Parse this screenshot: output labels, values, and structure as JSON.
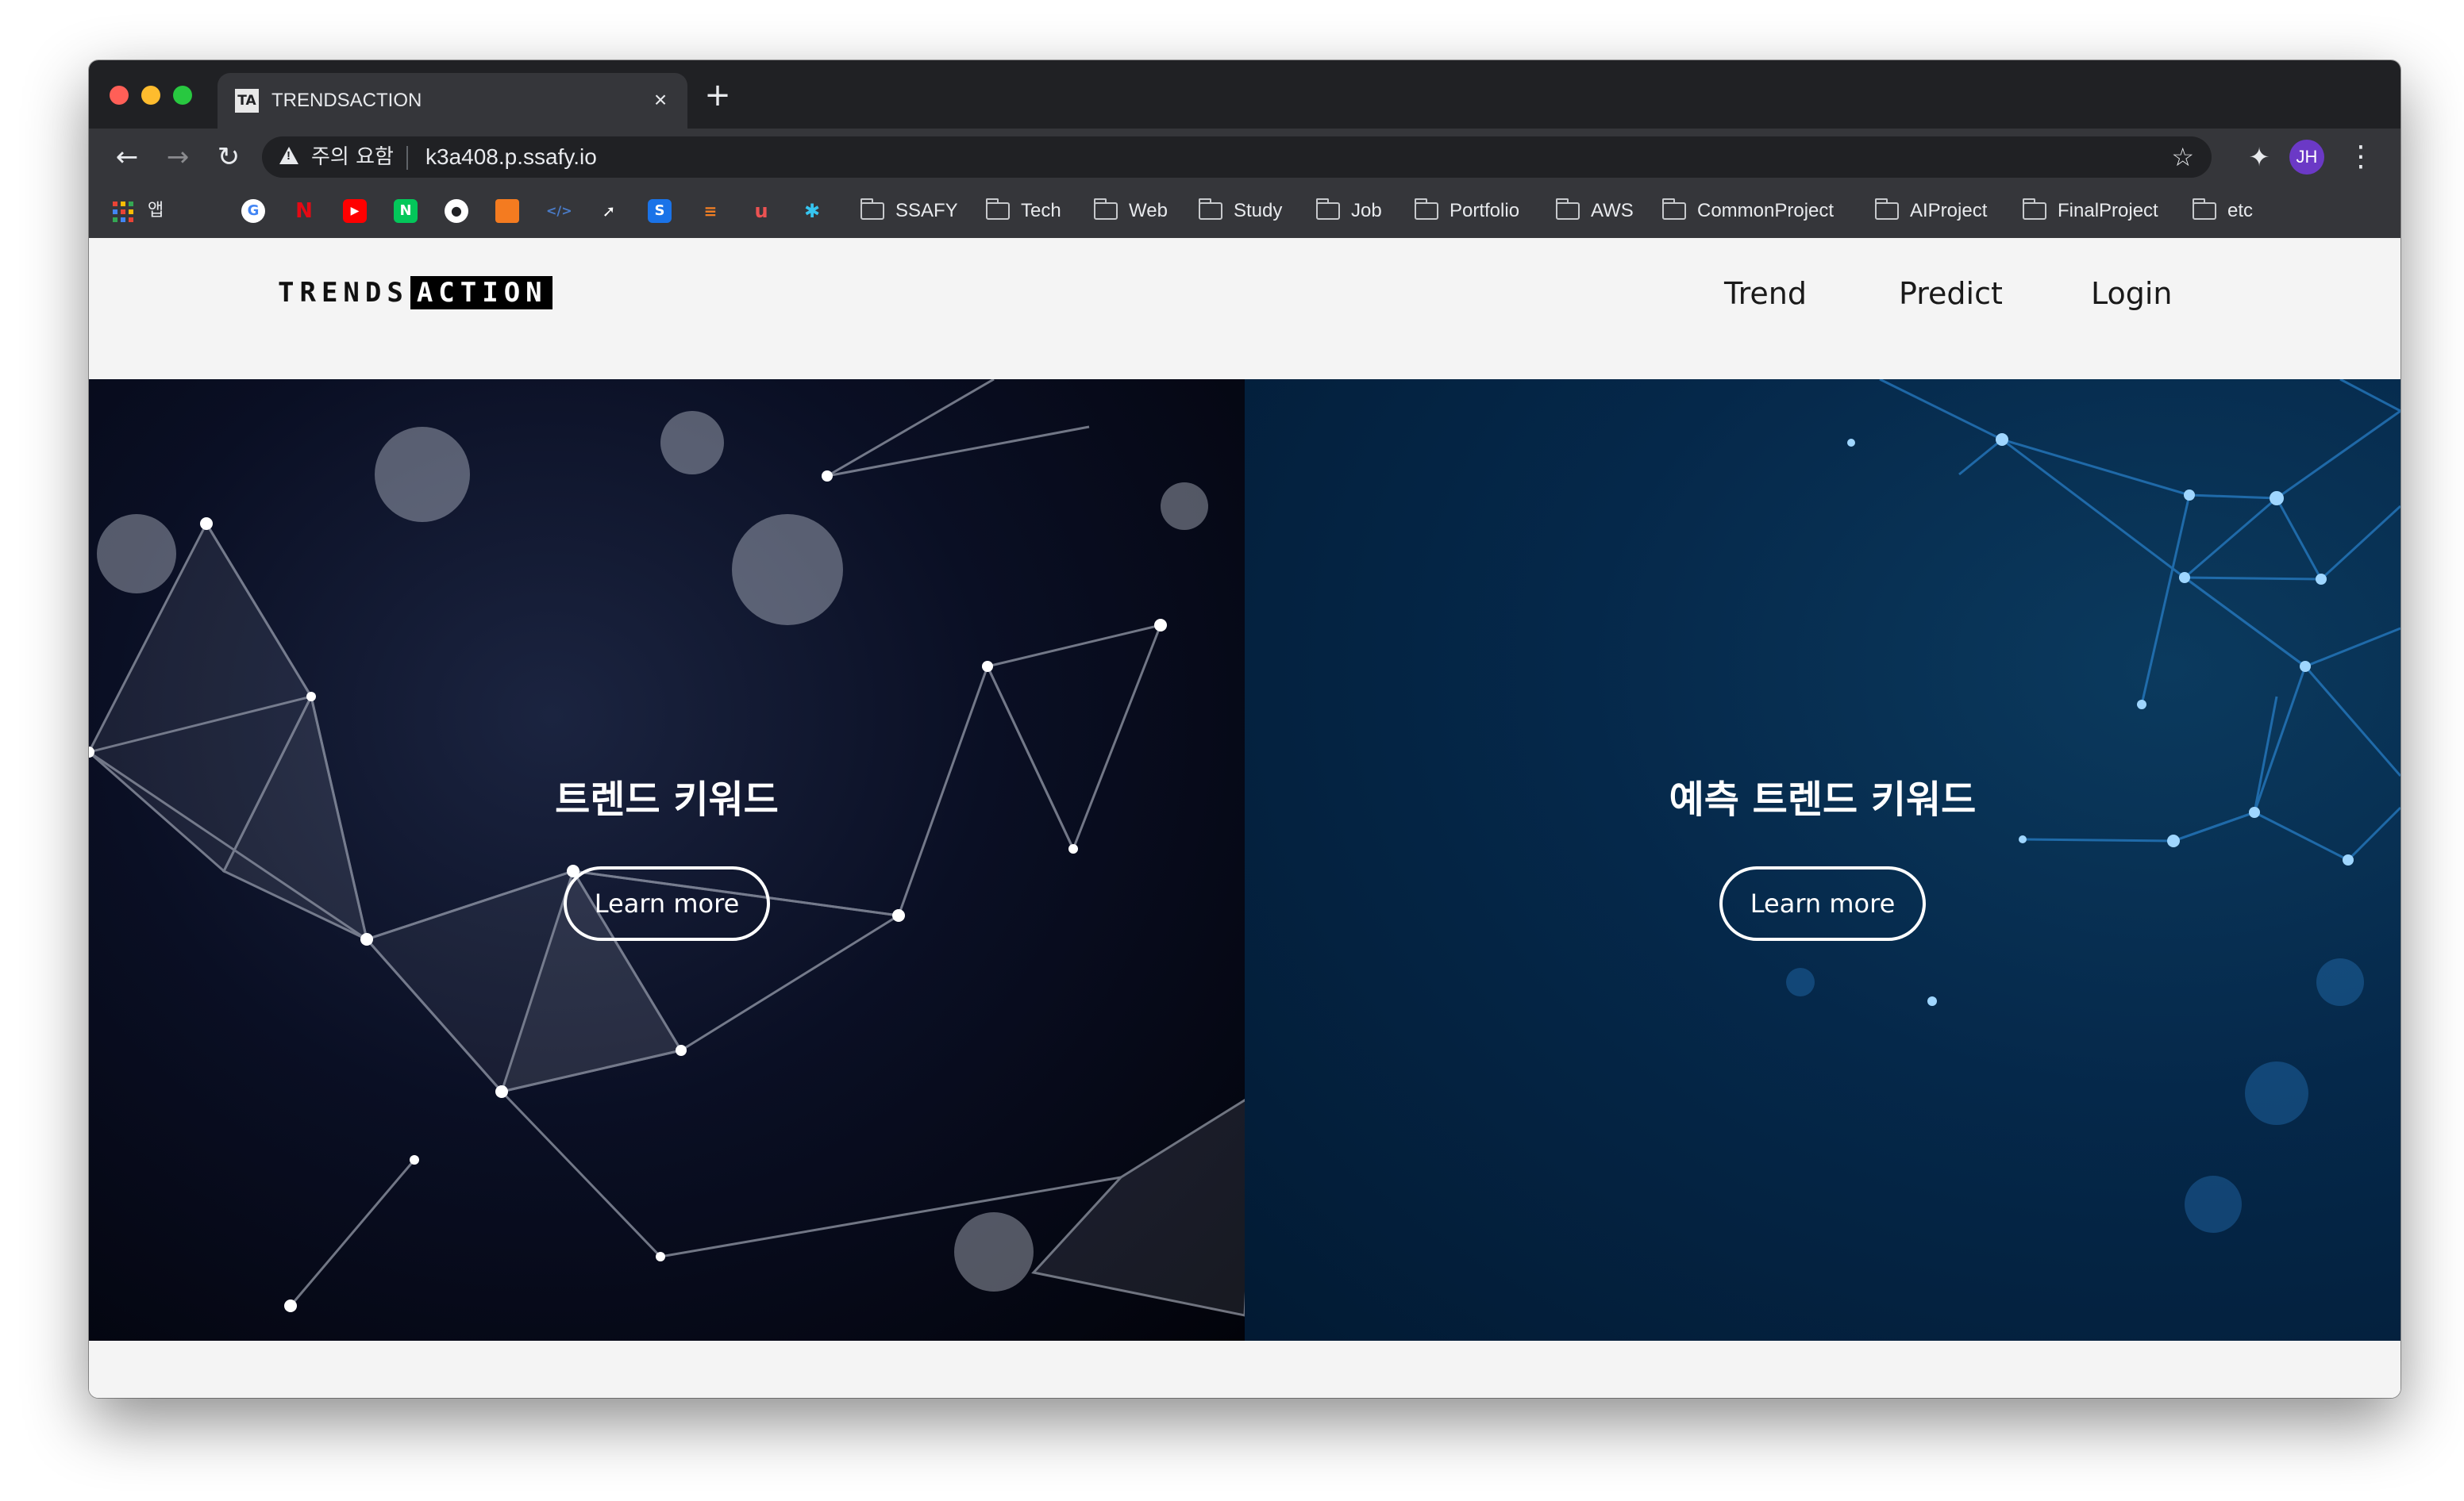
{
  "browser": {
    "tab": {
      "title": "TRENDSACTION",
      "favicon_text": "TA"
    },
    "address": {
      "warning_text": "주의 요함",
      "url": "k3a408.p.ssafy.io"
    },
    "profile_initials": "JH",
    "bookmarks": {
      "apps_label": "앱",
      "folders": [
        "SSAFY",
        "Tech",
        "Web",
        "Study",
        "Job",
        "Portfolio",
        "AWS",
        "CommonProject",
        "AIProject",
        "FinalProject",
        "etc"
      ]
    }
  },
  "site": {
    "logo": {
      "part1": "TRENDS",
      "part2": "ACTION"
    },
    "nav": {
      "trend": "Trend",
      "predict": "Predict",
      "login": "Login"
    },
    "hero_left": {
      "title": "트렌드 키워드",
      "button": "Learn more"
    },
    "hero_right": {
      "title": "예측 트렌드 키워드",
      "button": "Learn more"
    }
  },
  "colors": {
    "chrome_dark": "#202124",
    "chrome_toolbar": "#35363a",
    "page_bg": "#f4f4f4",
    "avatar": "#6b39c6",
    "hero_left_bg": "#0a0f24",
    "hero_right_bg": "#05284a",
    "network_left": "#d9dde6",
    "network_right": "#3aa4ff"
  }
}
